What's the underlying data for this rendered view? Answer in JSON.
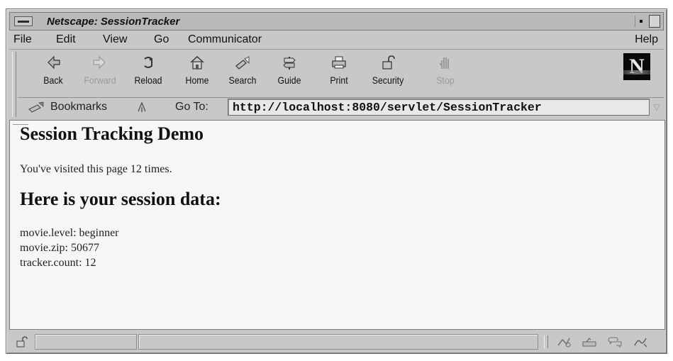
{
  "window": {
    "title": "Netscape: SessionTracker"
  },
  "menubar": {
    "items": [
      "File",
      "Edit",
      "View",
      "Go",
      "Communicator"
    ],
    "help": "Help"
  },
  "toolbar": {
    "buttons": [
      {
        "label": "Back",
        "icon": "back-arrow-icon",
        "enabled": true
      },
      {
        "label": "Forward",
        "icon": "forward-arrow-icon",
        "enabled": false
      },
      {
        "label": "Reload",
        "icon": "reload-icon",
        "enabled": true
      },
      {
        "label": "Home",
        "icon": "home-icon",
        "enabled": true
      },
      {
        "label": "Search",
        "icon": "search-flashlight-icon",
        "enabled": true
      },
      {
        "label": "Guide",
        "icon": "guide-signpost-icon",
        "enabled": true
      },
      {
        "label": "Print",
        "icon": "printer-icon",
        "enabled": true
      },
      {
        "label": "Security",
        "icon": "padlock-icon",
        "enabled": true
      },
      {
        "label": "Stop",
        "icon": "stop-hand-icon",
        "enabled": false
      }
    ],
    "logo_letter": "N"
  },
  "location": {
    "bookmarks_label": "Bookmarks",
    "goto_label": "Go To:",
    "url": "http://localhost:8080/servlet/SessionTracker"
  },
  "page": {
    "heading": "Session Tracking Demo",
    "visits_text": "You've visited this page 12 times.",
    "session_heading": "Here is your session data:",
    "session_entries": [
      "movie.level: beginner",
      "movie.zip: 50677",
      "tracker.count: 12"
    ]
  },
  "statusbar": {
    "status_text": "",
    "icons": [
      "component-bar-navigator-icon",
      "mail-icon",
      "discussion-icon",
      "composer-icon"
    ]
  }
}
